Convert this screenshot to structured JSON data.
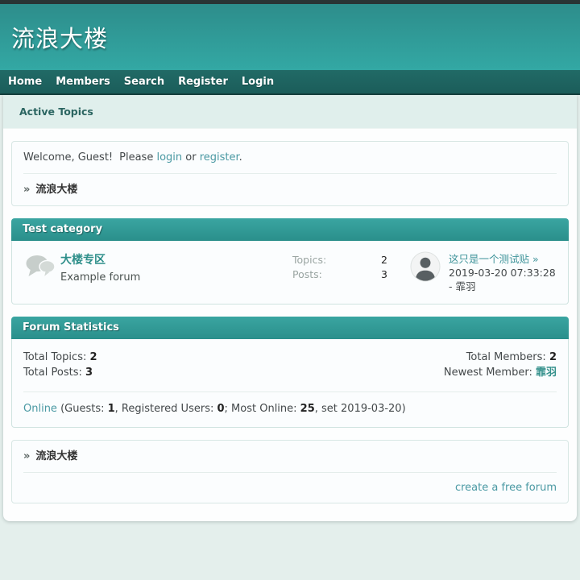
{
  "colors": {
    "brand_teal": "#2e9e9a",
    "nav_teal": "#1d6360",
    "subnav_bg": "#e0efec",
    "page_bg": "#e4efec",
    "link_teal": "#4a99a3",
    "forum_link_teal": "#2e8f8a"
  },
  "header": {
    "title": "流浪大楼"
  },
  "nav": {
    "items": [
      {
        "label": "Home"
      },
      {
        "label": "Members"
      },
      {
        "label": "Search"
      },
      {
        "label": "Register"
      },
      {
        "label": "Login"
      }
    ]
  },
  "subnav": {
    "active_topics": "Active Topics"
  },
  "welcome": {
    "greeting": "Welcome, Guest!",
    "please": "Please",
    "login": "login",
    "or": "or",
    "register": "register",
    "period": "."
  },
  "breadcrumb": {
    "arrow": "»",
    "site": "流浪大楼"
  },
  "category": {
    "title": "Test category",
    "forum": {
      "name": "大楼专区",
      "description": "Example forum",
      "topics_label": "Topics:",
      "topics_value": "2",
      "posts_label": "Posts:",
      "posts_value": "3",
      "lastpost": {
        "title": "这只是一个测试贴",
        "arrow": "»",
        "datetime": "2019-03-20 07:33:28 -",
        "author": "霏羽"
      }
    }
  },
  "stats": {
    "title": "Forum Statistics",
    "total_topics_label": "Total Topics:",
    "total_topics": "2",
    "total_posts_label": "Total Posts:",
    "total_posts": "3",
    "total_members_label": "Total Members:",
    "total_members": "2",
    "newest_member_label": "Newest Member:",
    "newest_member": "霏羽",
    "online": {
      "link": "Online",
      "part1": "(Guests: ",
      "guests": "1",
      "part2": ", Registered Users: ",
      "registered": "0",
      "part3": "; Most Online: ",
      "most_online": "25",
      "part4": ", set 2019-03-20)"
    }
  },
  "footer": {
    "create_forum": "create a free forum"
  }
}
